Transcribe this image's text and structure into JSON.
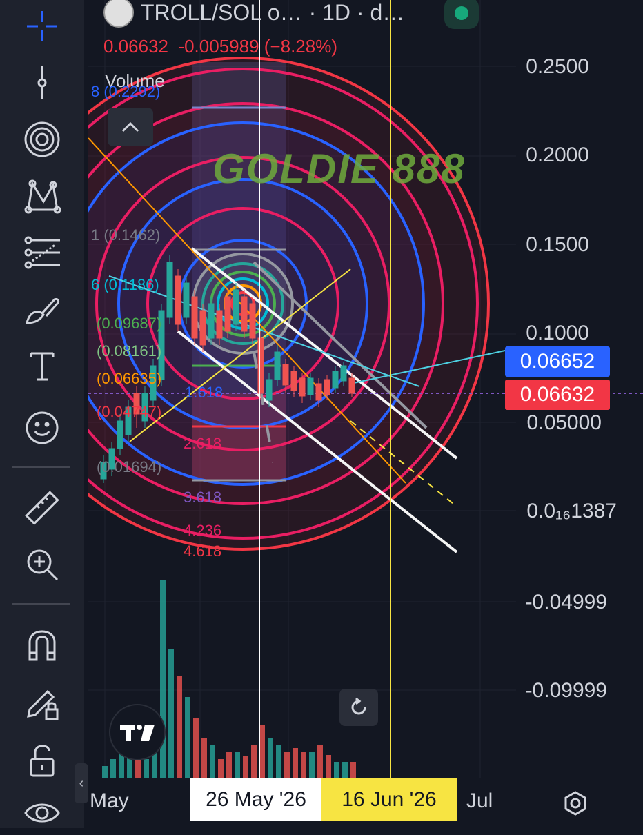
{
  "legend": {
    "symbol": "TROLL/SOL o…",
    "interval": "· 1D · d…",
    "last": "0.06632",
    "change": "-0.005989 (−8.28%)",
    "volume_label": "Volume"
  },
  "watermark": "GOLDIE 888",
  "price_axis": [
    "0.2500",
    "0.2000",
    "0.1500",
    "0.1000",
    "0.05000",
    "0.0₁₆1387",
    "-0.04999",
    "-0.09999"
  ],
  "price_badges": {
    "blue": "0.06652",
    "red": "0.06632"
  },
  "fib_labels": [
    {
      "text": "8 (0.2292)",
      "color": "#2962ff"
    },
    {
      "text": "1 (0.1462)",
      "color": "#787b86"
    },
    {
      "text": "6 (0.1186)",
      "color": "#00bcd4"
    },
    {
      "text": "(0.09687)",
      "color": "#4caf50"
    },
    {
      "text": "(0.08161)",
      "color": "#81c784"
    },
    {
      "text": "(0.06635)",
      "color": "#ff9800"
    },
    {
      "text": "(0.04747)",
      "color": "#f23645"
    },
    {
      "text": "(0.01694)",
      "color": "#787b86"
    }
  ],
  "fib_ext_labels": [
    {
      "text": "1.618",
      "color": "#2962ff"
    },
    {
      "text": "2.618",
      "color": "#e91e63"
    },
    {
      "text": "3.618",
      "color": "#7e57c2"
    },
    {
      "text": "4.236",
      "color": "#e91e63"
    },
    {
      "text": "4.618",
      "color": "#f23645"
    }
  ],
  "time_axis": {
    "left": "May",
    "box1": "26 May '26",
    "box2": "16 Jun '26",
    "right": "Jul"
  },
  "colors": {
    "up": "#26a69a",
    "down": "#ef5350",
    "accent_blue": "#2962ff",
    "accent_red": "#f23645",
    "bg": "#131722",
    "marker_yellow": "#f7e442"
  },
  "toolbar": [
    "crosshair-icon",
    "trend-line-icon",
    "fib-circle-icon",
    "pattern-icon",
    "forecast-icon",
    "brush-icon",
    "text-icon",
    "emoji-icon",
    "ruler-icon",
    "zoom-in-icon",
    "magnet-icon",
    "lock-drawing-icon",
    "unlock-icon",
    "eye-icon"
  ]
}
